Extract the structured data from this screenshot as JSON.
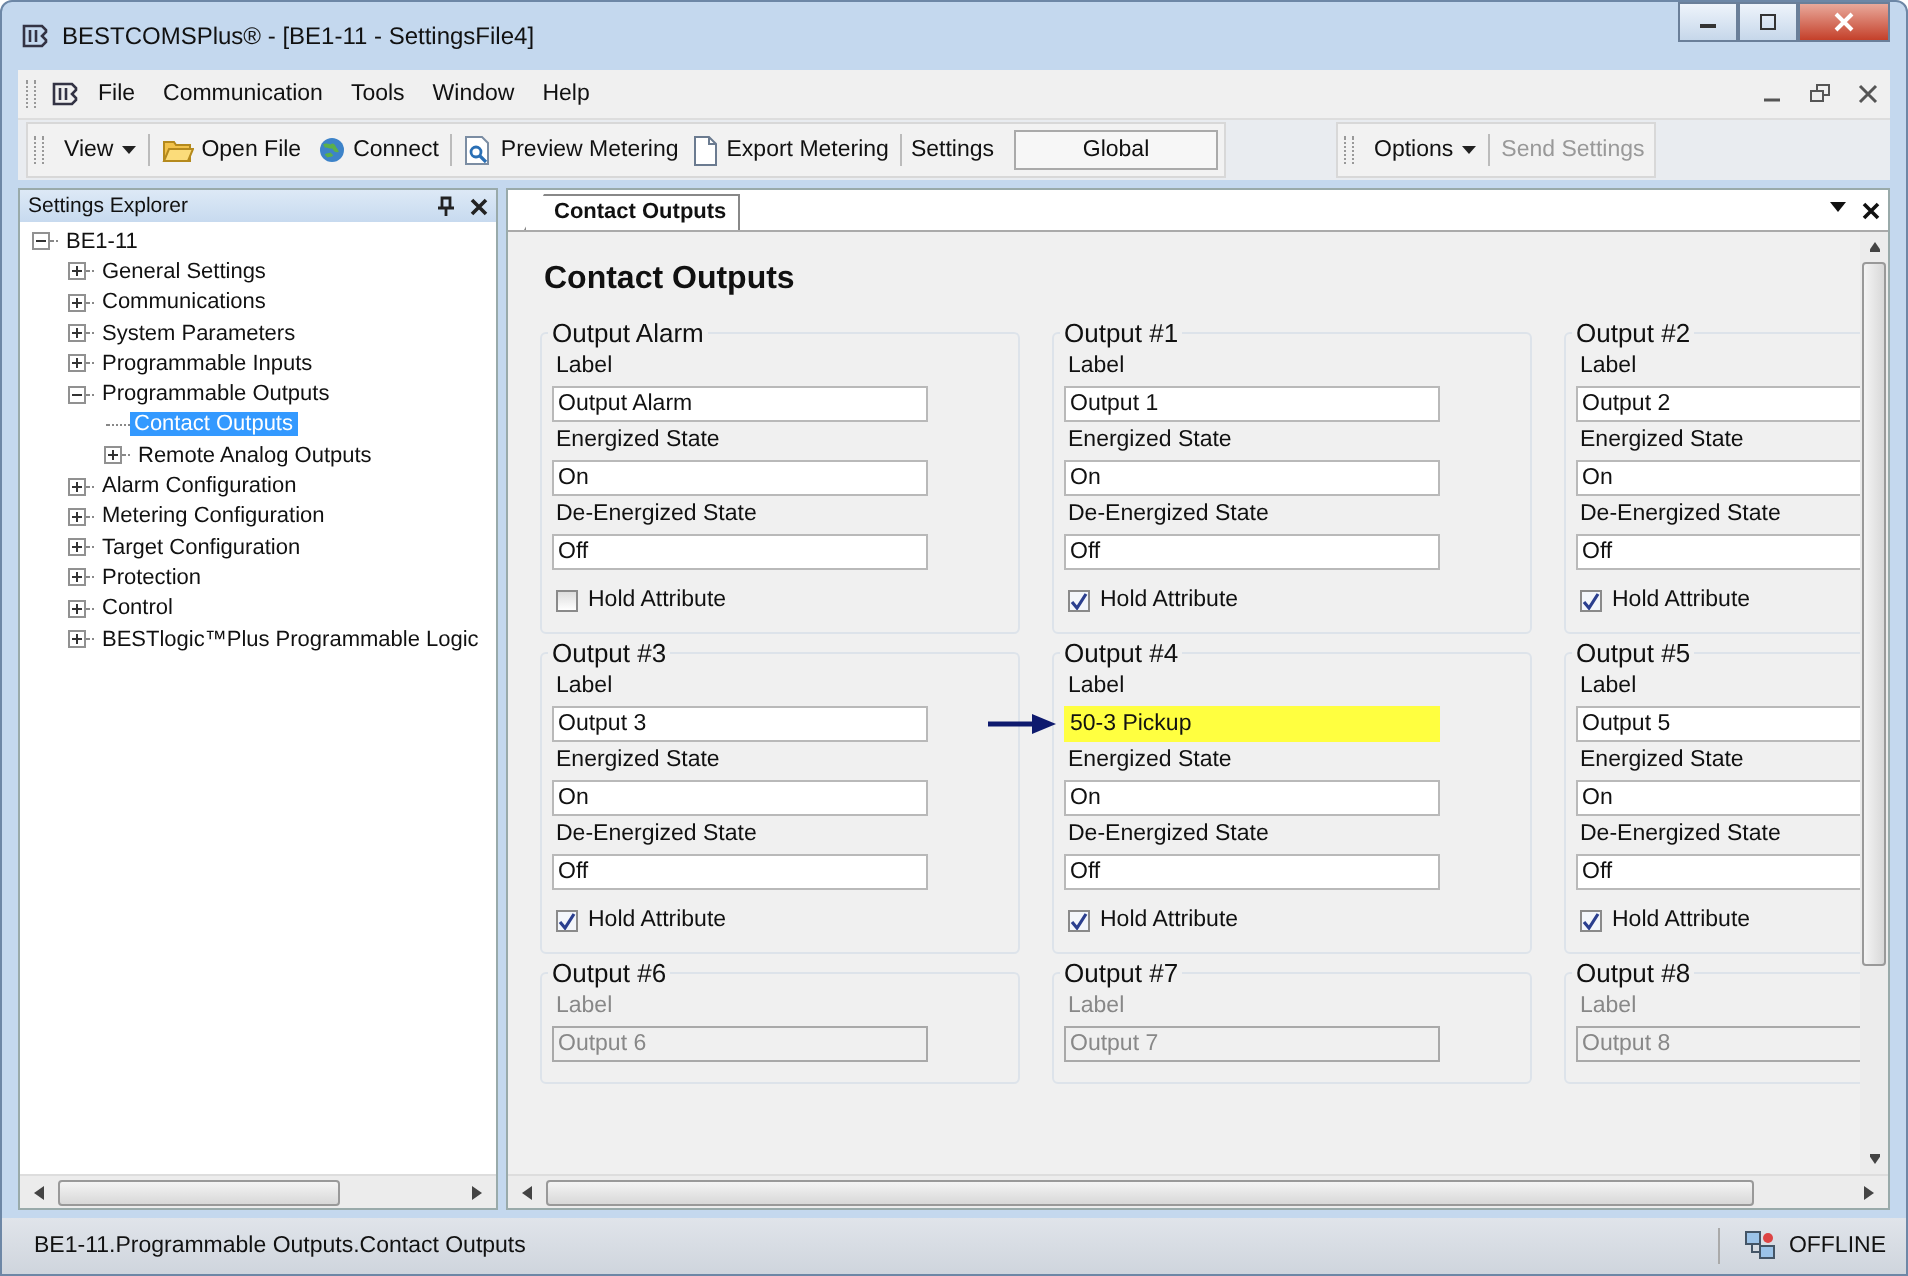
{
  "window": {
    "title": "BESTCOMSPlus® - [BE1-11 - SettingsFile4]"
  },
  "menu": [
    "File",
    "Communication",
    "Tools",
    "Window",
    "Help"
  ],
  "toolbar": {
    "view": "View",
    "open_file": "Open File",
    "connect": "Connect",
    "preview_metering": "Preview Metering",
    "export_metering": "Export Metering",
    "settings_label": "Settings",
    "settings_value": "Global",
    "options": "Options",
    "send_settings": {
      "label": "Send Settings",
      "disabled": true
    }
  },
  "explorer": {
    "title": "Settings Explorer",
    "tree": [
      {
        "label": "BE1-11",
        "expanded": true,
        "selected": false,
        "children": [
          {
            "label": "General Settings",
            "expanded": false,
            "selected": false
          },
          {
            "label": "Communications",
            "expanded": false,
            "selected": false
          },
          {
            "label": "System Parameters",
            "expanded": false,
            "selected": false
          },
          {
            "label": "Programmable Inputs",
            "expanded": false,
            "selected": false
          },
          {
            "label": "Programmable Outputs",
            "expanded": true,
            "selected": false,
            "children": [
              {
                "label": "Contact Outputs",
                "selected": true
              },
              {
                "label": "Remote Analog Outputs",
                "expanded": false,
                "selected": false
              }
            ]
          },
          {
            "label": "Alarm Configuration",
            "expanded": false,
            "selected": false
          },
          {
            "label": "Metering Configuration",
            "expanded": false,
            "selected": false
          },
          {
            "label": "Target Configuration",
            "expanded": false,
            "selected": false
          },
          {
            "label": "Protection",
            "expanded": false,
            "selected": false
          },
          {
            "label": "Control",
            "expanded": false,
            "selected": false
          },
          {
            "label": "BESTlogic™Plus Programmable Logic",
            "expanded": false,
            "selected": false
          }
        ]
      }
    ]
  },
  "document_tabs": [
    {
      "label": "Contact Outputs",
      "selected": true
    }
  ],
  "heading": "Contact Outputs",
  "groups": [
    {
      "title": "Output Alarm",
      "disabled": false,
      "label_caption": "Label",
      "label_value": "Output Alarm",
      "highlighted": false,
      "pointer_arrow": false,
      "energized_caption": "Energized State",
      "energized_value": "On",
      "deenergized_caption": "De-Energized State",
      "deenergized_value": "Off",
      "hold_caption": "Hold Attribute",
      "hold_checked": false
    },
    {
      "title": "Output #1",
      "disabled": false,
      "label_caption": "Label",
      "label_value": "Output 1",
      "highlighted": false,
      "pointer_arrow": false,
      "energized_caption": "Energized State",
      "energized_value": "On",
      "deenergized_caption": "De-Energized State",
      "deenergized_value": "Off",
      "hold_caption": "Hold Attribute",
      "hold_checked": true
    },
    {
      "title": "Output #2",
      "disabled": false,
      "label_caption": "Label",
      "label_value": "Output 2",
      "highlighted": false,
      "pointer_arrow": false,
      "energized_caption": "Energized State",
      "energized_value": "On",
      "deenergized_caption": "De-Energized State",
      "deenergized_value": "Off",
      "hold_caption": "Hold Attribute",
      "hold_checked": true
    },
    {
      "title": "Output #3",
      "disabled": false,
      "label_caption": "Label",
      "label_value": "Output 3",
      "highlighted": false,
      "pointer_arrow": false,
      "energized_caption": "Energized State",
      "energized_value": "On",
      "deenergized_caption": "De-Energized State",
      "deenergized_value": "Off",
      "hold_caption": "Hold Attribute",
      "hold_checked": true
    },
    {
      "title": "Output #4",
      "disabled": false,
      "label_caption": "Label",
      "label_value": "50-3 Pickup",
      "highlighted": true,
      "pointer_arrow": true,
      "energized_caption": "Energized State",
      "energized_value": "On",
      "deenergized_caption": "De-Energized State",
      "deenergized_value": "Off",
      "hold_caption": "Hold Attribute",
      "hold_checked": true
    },
    {
      "title": "Output #5",
      "disabled": false,
      "label_caption": "Label",
      "label_value": "Output 5",
      "highlighted": false,
      "pointer_arrow": false,
      "energized_caption": "Energized State",
      "energized_value": "On",
      "deenergized_caption": "De-Energized State",
      "deenergized_value": "Off",
      "hold_caption": "Hold Attribute",
      "hold_checked": true
    },
    {
      "title": "Output #6",
      "disabled": true,
      "label_caption": "Label",
      "label_value": "Output 6",
      "highlighted": false,
      "pointer_arrow": false
    },
    {
      "title": "Output #7",
      "disabled": true,
      "label_caption": "Label",
      "label_value": "Output 7",
      "highlighted": false,
      "pointer_arrow": false
    },
    {
      "title": "Output #8",
      "disabled": true,
      "label_caption": "Label",
      "label_value": "Output 8",
      "highlighted": false,
      "pointer_arrow": false
    }
  ],
  "status_bar": {
    "path": "BE1-11.Programmable Outputs.Contact Outputs",
    "connection": "OFFLINE"
  }
}
